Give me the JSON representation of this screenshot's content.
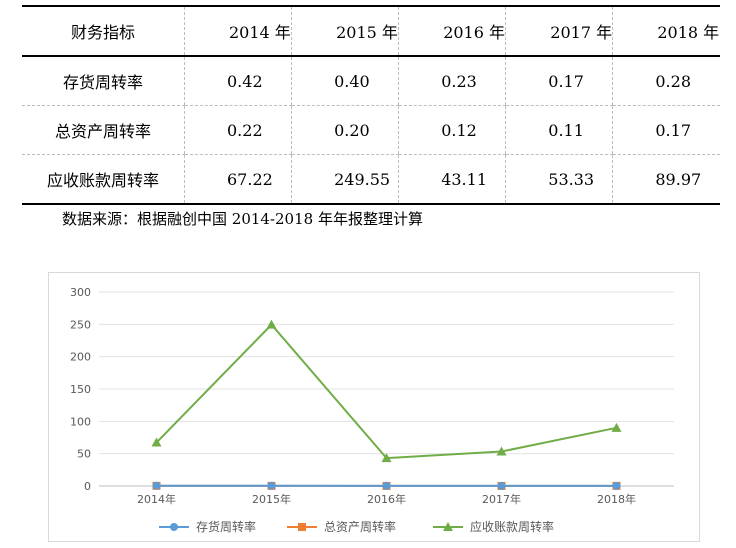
{
  "table": {
    "header_label": "财务指标",
    "years": [
      "2014 年",
      "2015 年",
      "2016 年",
      "2017 年",
      "2018 年"
    ],
    "rows": [
      {
        "label": "存货周转率",
        "values": [
          "0.42",
          "0.40",
          "0.23",
          "0.17",
          "0.28"
        ]
      },
      {
        "label": "总资产周转率",
        "values": [
          "0.22",
          "0.20",
          "0.12",
          "0.11",
          "0.17"
        ]
      },
      {
        "label": "应收账款周转率",
        "values": [
          "67.22",
          "249.55",
          "43.11",
          "53.33",
          "89.97"
        ]
      }
    ]
  },
  "source_note": "数据来源：根据融创中国 2014-2018 年年报整理计算",
  "chart_data": {
    "type": "line",
    "categories": [
      "2014年",
      "2015年",
      "2016年",
      "2017年",
      "2018年"
    ],
    "ylim": [
      0,
      300
    ],
    "yticks": [
      0,
      50,
      100,
      150,
      200,
      250,
      300
    ],
    "grid": true,
    "legend_position": "bottom",
    "series": [
      {
        "name": "存货周转率",
        "values": [
          0.42,
          0.4,
          0.23,
          0.17,
          0.28
        ],
        "color": "#5b9bd5",
        "marker": "circle"
      },
      {
        "name": "总资产周转率",
        "values": [
          0.22,
          0.2,
          0.12,
          0.11,
          0.17
        ],
        "color": "#ed7d31",
        "marker": "square"
      },
      {
        "name": "应收账款周转率",
        "values": [
          67.22,
          249.55,
          43.11,
          53.33,
          89.97
        ],
        "color": "#70ad47",
        "marker": "triangle"
      }
    ]
  }
}
